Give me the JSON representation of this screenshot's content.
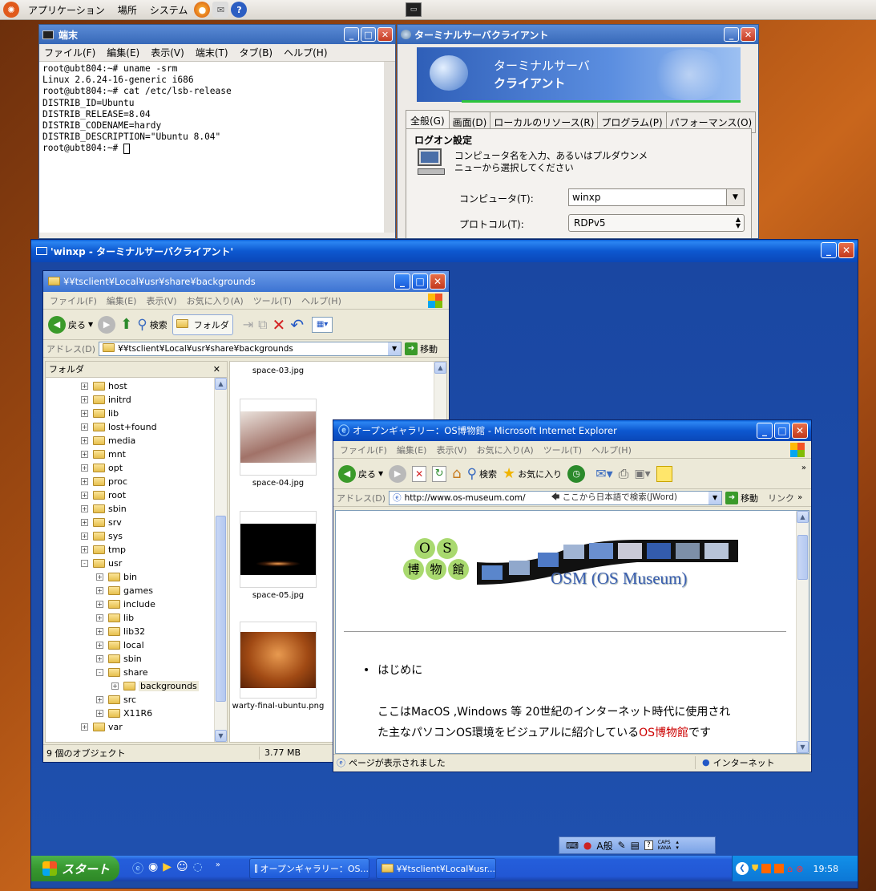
{
  "topbar": {
    "menus": [
      "アプリケーション",
      "場所",
      "システム"
    ],
    "icons": [
      "ubuntu-logo-icon",
      "firefox-icon",
      "mail-icon",
      "help-icon",
      "terminal-launcher-icon"
    ]
  },
  "terminal": {
    "title": "端末",
    "menus": [
      "ファイル(F)",
      "編集(E)",
      "表示(V)",
      "端末(T)",
      "タブ(B)",
      "ヘルプ(H)"
    ],
    "lines": [
      "root@ubt804:~# uname -srm",
      "Linux 2.6.24-16-generic i686",
      "root@ubt804:~# cat /etc/lsb-release",
      "DISTRIB_ID=Ubuntu",
      "DISTRIB_RELEASE=8.04",
      "DISTRIB_CODENAME=hardy",
      "DISTRIB_DESCRIPTION=\"Ubuntu 8.04\"",
      "root@ubt804:~# "
    ]
  },
  "tsclient": {
    "title": "ターミナルサーバクライアント",
    "banner_line1": "ターミナルサーバ",
    "banner_line2": "クライアント",
    "tabs": [
      "全般(G)",
      "画面(D)",
      "ローカルのリソース(R)",
      "プログラム(P)",
      "パフォーマンス(O)"
    ],
    "section": "ログオン設定",
    "description": "コンピュータ名を入力、あるいはプルダウンメニューから選択してください",
    "computer_label": "コンピュータ(T):",
    "computer_value": "winxp",
    "protocol_label": "プロトコル(T):",
    "protocol_value": "RDPv5"
  },
  "rdp": {
    "title": "'winxp - ターミナルサーバクライアント'"
  },
  "explorer": {
    "title": "¥¥tsclient¥Local¥usr¥share¥backgrounds",
    "menus": [
      "ファイル(F)",
      "編集(E)",
      "表示(V)",
      "お気に入り(A)",
      "ツール(T)",
      "ヘルプ(H)"
    ],
    "back": "戻る",
    "search": "検索",
    "folders": "フォルダ",
    "address_label": "アドレス(D)",
    "address": "¥¥tsclient¥Local¥usr¥share¥backgrounds",
    "go": "移動",
    "pane_title": "フォルダ",
    "tree": [
      {
        "label": "host",
        "level": 0,
        "sign": "+"
      },
      {
        "label": "initrd",
        "level": 0,
        "sign": "+"
      },
      {
        "label": "lib",
        "level": 0,
        "sign": "+"
      },
      {
        "label": "lost+found",
        "level": 0,
        "sign": "+"
      },
      {
        "label": "media",
        "level": 0,
        "sign": "+"
      },
      {
        "label": "mnt",
        "level": 0,
        "sign": "+"
      },
      {
        "label": "opt",
        "level": 0,
        "sign": "+"
      },
      {
        "label": "proc",
        "level": 0,
        "sign": "+"
      },
      {
        "label": "root",
        "level": 0,
        "sign": "+"
      },
      {
        "label": "sbin",
        "level": 0,
        "sign": "+"
      },
      {
        "label": "srv",
        "level": 0,
        "sign": "+"
      },
      {
        "label": "sys",
        "level": 0,
        "sign": "+"
      },
      {
        "label": "tmp",
        "level": 0,
        "sign": "+"
      },
      {
        "label": "usr",
        "level": 0,
        "sign": "-"
      },
      {
        "label": "bin",
        "level": 1,
        "sign": "+"
      },
      {
        "label": "games",
        "level": 1,
        "sign": "+"
      },
      {
        "label": "include",
        "level": 1,
        "sign": "+"
      },
      {
        "label": "lib",
        "level": 1,
        "sign": "+"
      },
      {
        "label": "lib32",
        "level": 1,
        "sign": "+"
      },
      {
        "label": "local",
        "level": 1,
        "sign": "+"
      },
      {
        "label": "sbin",
        "level": 1,
        "sign": "+"
      },
      {
        "label": "share",
        "level": 1,
        "sign": "-"
      },
      {
        "label": "backgrounds",
        "level": 2,
        "sign": "+"
      },
      {
        "label": "src",
        "level": 1,
        "sign": "+"
      },
      {
        "label": "X11R6",
        "level": 1,
        "sign": "+"
      },
      {
        "label": "var",
        "level": 0,
        "sign": "+"
      }
    ],
    "files": [
      "space-03.jpg",
      "space-04.jpg",
      "space-05.jpg",
      "warty-final-ubuntu.png"
    ],
    "status_count": "9 個のオブジェクト",
    "status_size": "3.77 MB"
  },
  "ie": {
    "title": "オープンギャラリー：OS博物館 - Microsoft Internet Explorer",
    "menus": [
      "ファイル(F)",
      "編集(E)",
      "表示(V)",
      "お気に入り(A)",
      "ツール(T)",
      "ヘルプ(H)"
    ],
    "back": "戻る",
    "search": "検索",
    "favorites": "お気に入り",
    "address_label": "アドレス(D)",
    "address": "http://www.os-museum.com/",
    "search_hint": "ここから日本語で検索(JWord)",
    "go": "移動",
    "links": "リンク",
    "logo_chars": [
      "O",
      "S",
      "博",
      "物",
      "館"
    ],
    "osm_title": "OSM (OS Museum)",
    "bullet": "はじめに",
    "para_line1": "ここはMacOS ,Windows 等 20世紀のインターネット時代に使用され",
    "para_line2_pre": "た主なパソコンOS環境をビジュアルに紹介している",
    "para_link": "OS博物館",
    "para_line2_post": "です",
    "status": "ページが表示されました",
    "zone": "インターネット"
  },
  "taskbar": {
    "start": "スタート",
    "tasks": [
      "オープンギャラリー：OS...",
      "¥¥tsclient¥Local¥usr..."
    ],
    "ime_mode": "A般",
    "caps": "CAPS",
    "kana": "KANA",
    "time": "19:58"
  },
  "colors": {
    "xp_blue": "#0a47b8",
    "desktop": "#1d4ba5",
    "link_red": "#cc0000",
    "osm_blue": "#3b5fb0"
  }
}
